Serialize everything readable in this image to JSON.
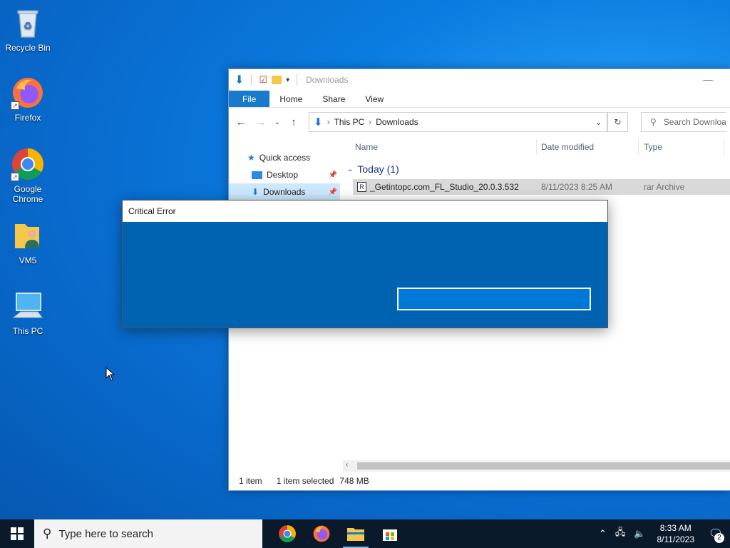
{
  "desktop": {
    "icons": [
      {
        "label": "Recycle Bin"
      },
      {
        "label": "Firefox"
      },
      {
        "label": "Google Chrome"
      },
      {
        "label": "VM5"
      },
      {
        "label": "This PC"
      }
    ]
  },
  "explorer": {
    "title": "Downloads",
    "ribbon_tabs": [
      "File",
      "Home",
      "Share",
      "View"
    ],
    "breadcrumb": [
      "This PC",
      "Downloads"
    ],
    "search_placeholder": "Search Downloads",
    "nav": [
      {
        "label": "Quick access"
      },
      {
        "label": "Desktop"
      },
      {
        "label": "Downloads"
      }
    ],
    "columns": [
      "Name",
      "Date modified",
      "Type"
    ],
    "group_label": "Today (1)",
    "files": [
      {
        "name": "_Getintopc.com_FL_Studio_20.0.3.532",
        "date": "8/11/2023 8:25 AM",
        "type": "rar Archive"
      }
    ],
    "status": {
      "items": "1 item",
      "selected": "1 item selected",
      "size": "748 MB"
    }
  },
  "dialog": {
    "title": "Critical Error",
    "button_label": ""
  },
  "taskbar": {
    "search_placeholder": "Type here to search",
    "time": "8:33 AM",
    "date": "8/11/2023",
    "notification_count": "2"
  },
  "colors": {
    "dialog_bg": "#0063b1",
    "accent": "#0078d7",
    "taskbar": "#0b1a2b"
  }
}
